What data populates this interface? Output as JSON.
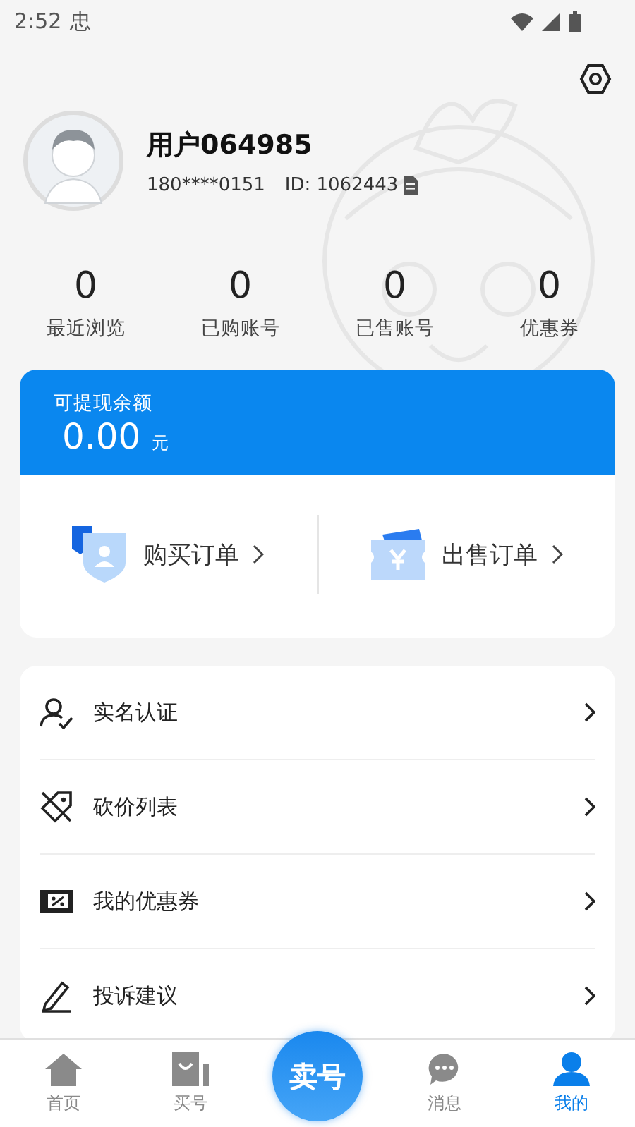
{
  "status_bar": {
    "time": "2:52",
    "notification_glyph": "忠"
  },
  "profile": {
    "name": "用户064985",
    "phone": "180****0151",
    "id": "ID: 1062443"
  },
  "stats": [
    {
      "value": "0",
      "label": "最近浏览"
    },
    {
      "value": "0",
      "label": "已购账号"
    },
    {
      "value": "0",
      "label": "已售账号"
    },
    {
      "value": "0",
      "label": "优惠券"
    }
  ],
  "balance": {
    "label": "可提现余额",
    "amount": "0.00",
    "unit": "元"
  },
  "orders": [
    {
      "kind": "buy",
      "label": "购买订单"
    },
    {
      "kind": "sell",
      "label": "出售订单"
    }
  ],
  "menu": [
    {
      "kind": "verify",
      "label": "实名认证"
    },
    {
      "kind": "bargain",
      "label": "砍价列表"
    },
    {
      "kind": "coupon",
      "label": "我的优惠券"
    },
    {
      "kind": "complaint",
      "label": "投诉建议"
    }
  ],
  "nav": [
    {
      "kind": "home",
      "label": "首页",
      "selected": false
    },
    {
      "kind": "buy",
      "label": "买号",
      "selected": false
    },
    {
      "kind": "sell",
      "label": "卖号",
      "selected": false
    },
    {
      "kind": "message",
      "label": "消息",
      "selected": false
    },
    {
      "kind": "me",
      "label": "我的",
      "selected": true
    }
  ]
}
